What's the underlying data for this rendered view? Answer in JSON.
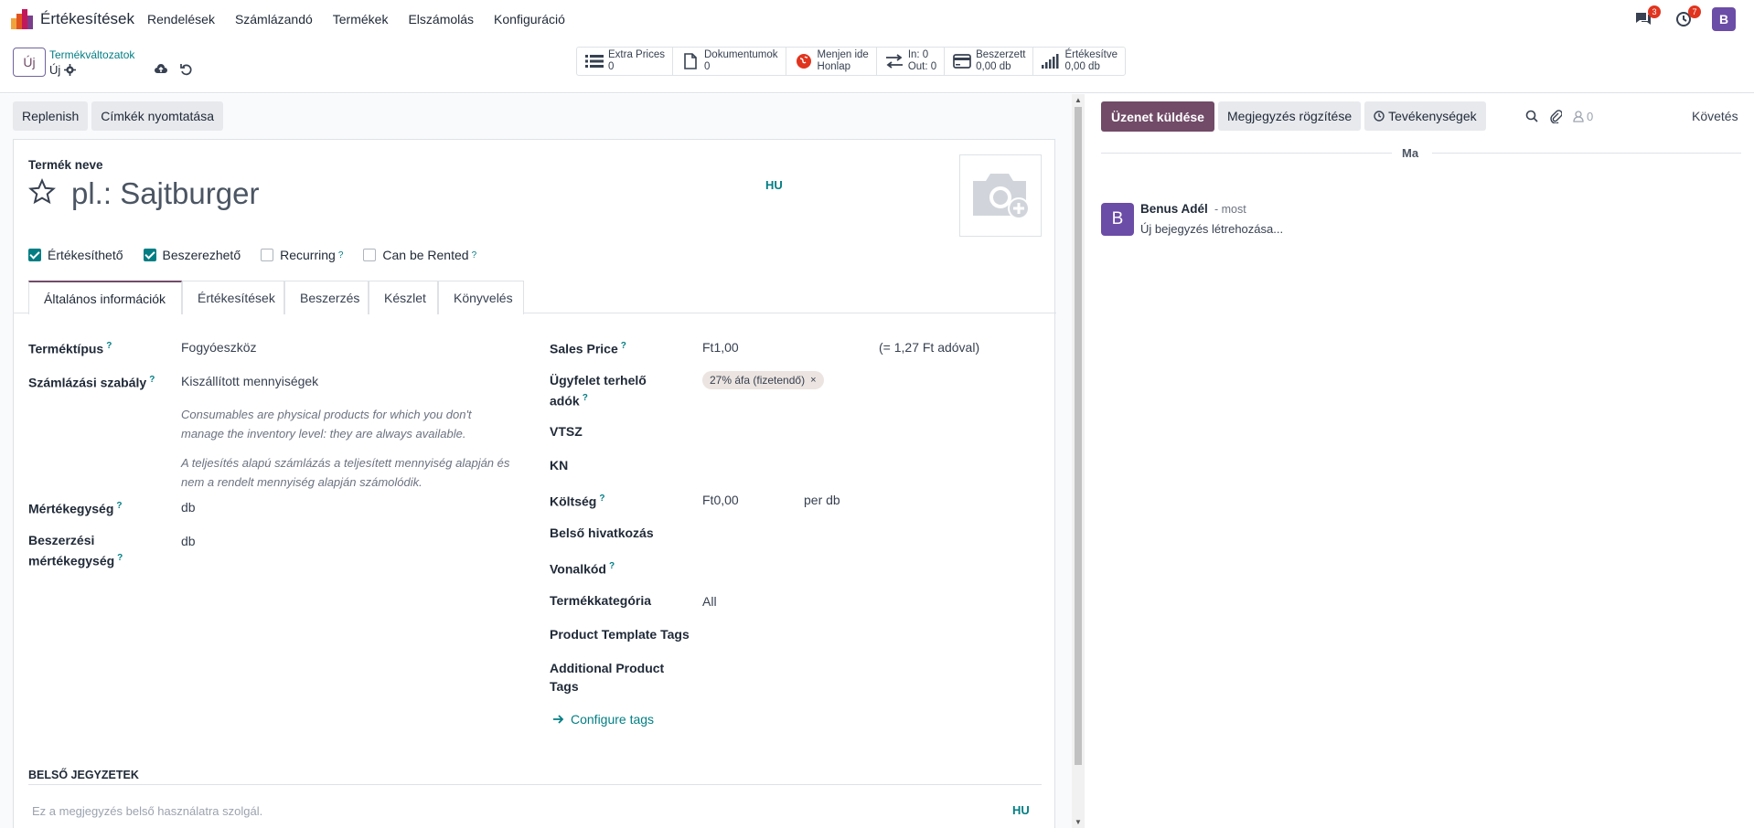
{
  "navbar": {
    "app_name": "Értékesítések",
    "menu": [
      "Rendelések",
      "Számlázandó",
      "Termékek",
      "Elszámolás",
      "Konfiguráció"
    ],
    "messages_count": "3",
    "activities_count": "7",
    "user_initial": "B"
  },
  "control_panel": {
    "new_label": "Új",
    "breadcrumb": "Termékváltozatok",
    "record_name": "Új",
    "stats": [
      {
        "icon": "list-icon",
        "line1": "Extra Prices",
        "line2": "0"
      },
      {
        "icon": "document-icon",
        "line1": "Dokumentumok",
        "line2": "0"
      },
      {
        "icon": "globe-icon",
        "line1": "Menjen ide",
        "line2": "Honlap"
      },
      {
        "icon": "transfer-icon",
        "line1": "In: 0",
        "line2": "Out: 0"
      },
      {
        "icon": "credit-card-icon",
        "line1": "Beszerzett",
        "line2": "0,00 db"
      },
      {
        "icon": "signal-icon",
        "line1": "Értékesítve",
        "line2": "0,00 db"
      }
    ]
  },
  "form": {
    "buttons": [
      "Replenish",
      "Címkék nyomtatása"
    ],
    "name_label": "Termék neve",
    "name_placeholder": "pl.: Sajtburger",
    "lang": "HU",
    "checkboxes": [
      {
        "label": "Értékesíthető",
        "checked": true,
        "help": false
      },
      {
        "label": "Beszerezhető",
        "checked": true,
        "help": false
      },
      {
        "label": "Recurring",
        "checked": false,
        "help": true
      },
      {
        "label": "Can be Rented",
        "checked": false,
        "help": true
      }
    ],
    "tabs": [
      "Általános információk",
      "Értékesítések",
      "Beszerzés",
      "Készlet",
      "Könyvelés"
    ],
    "left": {
      "type_label": "Terméktípus",
      "type_value": "Fogyóeszköz",
      "invoice_label": "Számlázási szabály",
      "invoice_value": "Kiszállított mennyiségek",
      "help1_line1": "Consumables are physical products for which you don't",
      "help1_line2": "manage the inventory level: they are always available.",
      "help2_line1": "A teljesítés alapú számlázás a teljesített mennyiség alapján és",
      "help2_line2": "nem a rendelt mennyiség alapján számolódik.",
      "uom_label": "Mértékegység",
      "uom_value": "db",
      "puom_label_1": "Beszerzési",
      "puom_label_2": "mértékegység",
      "puom_value": "db"
    },
    "right": {
      "sales_price_label": "Sales Price",
      "sales_price_value": "Ft1,00",
      "sales_price_tax": "(= 1,27 Ft adóval)",
      "customer_taxes_label_1": "Ügyfelet terhelő",
      "customer_taxes_label_2": "adók",
      "customer_tax_tag": "27% áfa (fizetendő)",
      "vtsz_label": "VTSZ",
      "kn_label": "KN",
      "cost_label": "Költség",
      "cost_value": "Ft0,00",
      "cost_unit": "per db",
      "internal_ref_label": "Belső hivatkozás",
      "barcode_label": "Vonalkód",
      "category_label": "Termékkategória",
      "category_value": "All",
      "template_tags_label": "Product Template Tags",
      "additional_tags_label_1": "Additional Product",
      "additional_tags_label_2": "Tags",
      "configure_tags": "Configure tags"
    },
    "notes_title": "BELSŐ JEGYZETEK",
    "notes_placeholder": "Ez a megjegyzés belső használatra szolgál.",
    "notes_lang": "HU"
  },
  "chatter": {
    "send_message": "Üzenet küldése",
    "log_note": "Megjegyzés rögzítése",
    "activities": "Tevékenységek",
    "followers_count": "0",
    "follow": "Követés",
    "date_separator": "Ma",
    "message": {
      "avatar": "B",
      "author": "Benus Adél",
      "time": "- most",
      "body": "Új bejegyzés létrehozása..."
    }
  },
  "colors": {
    "primary": "#714b67",
    "teal": "#017e84",
    "avatar": "#6b4ca6",
    "badge": "#e1341e"
  }
}
